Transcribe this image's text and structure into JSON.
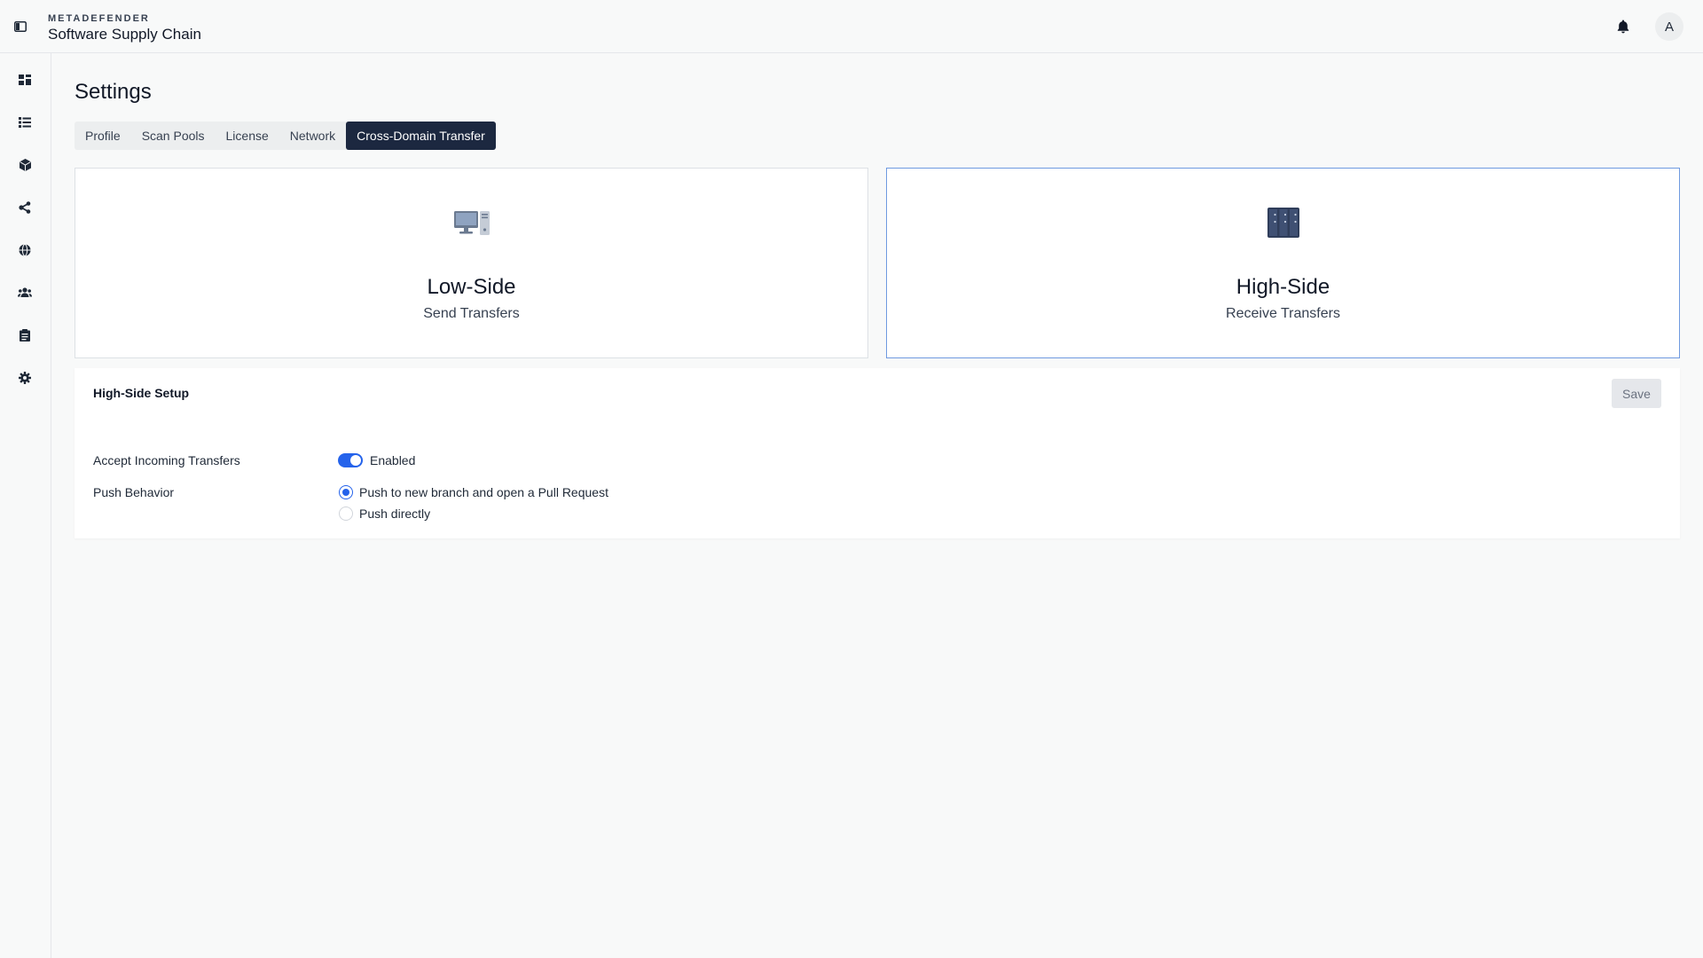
{
  "header": {
    "brand_sup": "METADEFENDER",
    "brand_title": "Software Supply Chain",
    "avatar_initial": "A"
  },
  "sidebar": {
    "items": [
      {
        "icon": "dashboard-icon"
      },
      {
        "icon": "list-icon"
      },
      {
        "icon": "package-icon"
      },
      {
        "icon": "share-nodes-icon"
      },
      {
        "icon": "globe-icon"
      },
      {
        "icon": "users-icon"
      },
      {
        "icon": "clipboard-icon"
      },
      {
        "icon": "gear-icon"
      }
    ],
    "bottom_icon": "spinner-icon"
  },
  "page": {
    "title": "Settings",
    "tabs": [
      {
        "label": "Profile",
        "active": false
      },
      {
        "label": "Scan Pools",
        "active": false
      },
      {
        "label": "License",
        "active": false
      },
      {
        "label": "Network",
        "active": false
      },
      {
        "label": "Cross-Domain Transfer",
        "active": true
      }
    ]
  },
  "mode_cards": {
    "low": {
      "title": "Low-Side",
      "subtitle": "Send Transfers",
      "icon": "desktop-computer-icon"
    },
    "high": {
      "title": "High-Side",
      "subtitle": "Receive Transfers",
      "icon": "server-rack-icon",
      "selected": true
    }
  },
  "setup": {
    "title": "High-Side Setup",
    "save_label": "Save",
    "accept_label": "Accept Incoming Transfers",
    "accept_state": "Enabled",
    "push_label": "Push Behavior",
    "push_options": [
      {
        "label": "Push to new branch and open a Pull Request",
        "checked": true
      },
      {
        "label": "Push directly",
        "checked": false
      }
    ]
  },
  "colors": {
    "accent": "#2563eb",
    "active_tab": "#1c2840",
    "selected_card_border": "#6f9ae0"
  }
}
